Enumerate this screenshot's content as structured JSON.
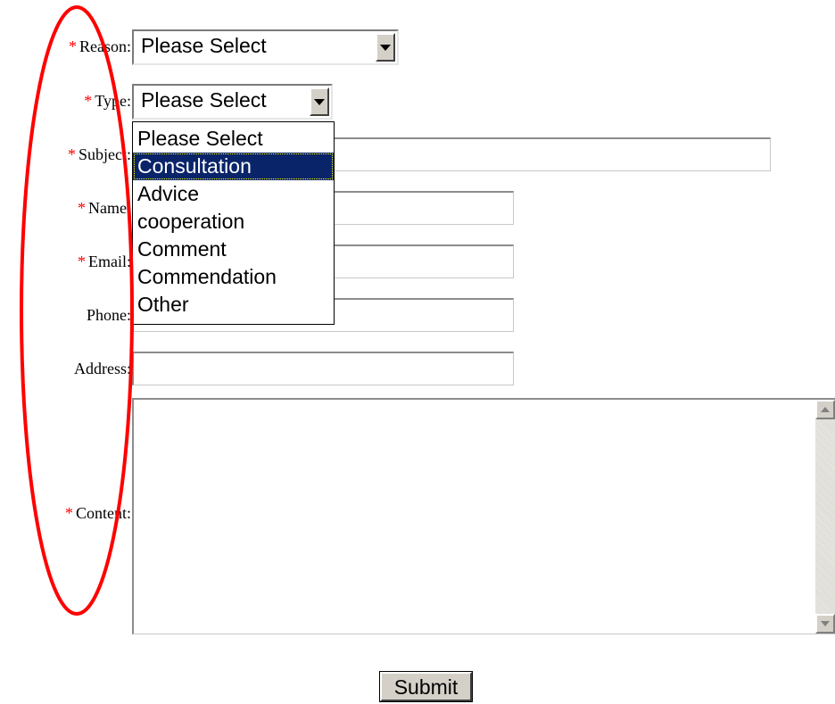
{
  "form": {
    "required_mark": "*",
    "fields": {
      "reason": {
        "label": "Reason:",
        "value": "Please Select"
      },
      "type": {
        "label": "Type:",
        "value": "Please Select"
      },
      "subject": {
        "label": "Subject:",
        "value": ""
      },
      "name": {
        "label": "Name:",
        "value": ""
      },
      "email": {
        "label": "Email:",
        "value": ""
      },
      "phone": {
        "label": "Phone:",
        "value": ""
      },
      "address": {
        "label": "Address:",
        "value": ""
      },
      "content": {
        "label": "Content:",
        "value": ""
      }
    },
    "type_dropdown": {
      "options": [
        "Please Select",
        "Consultation",
        "Advice",
        "cooperation",
        "Comment",
        "Commendation",
        "Other"
      ],
      "highlighted": "Consultation"
    },
    "submit_label": "Submit"
  },
  "annotation": {
    "shape": "ellipse",
    "color": "#ff0000"
  },
  "colors": {
    "required": "#ff0000",
    "highlight": "#0a246a",
    "button_face": "#d4d0c8"
  }
}
